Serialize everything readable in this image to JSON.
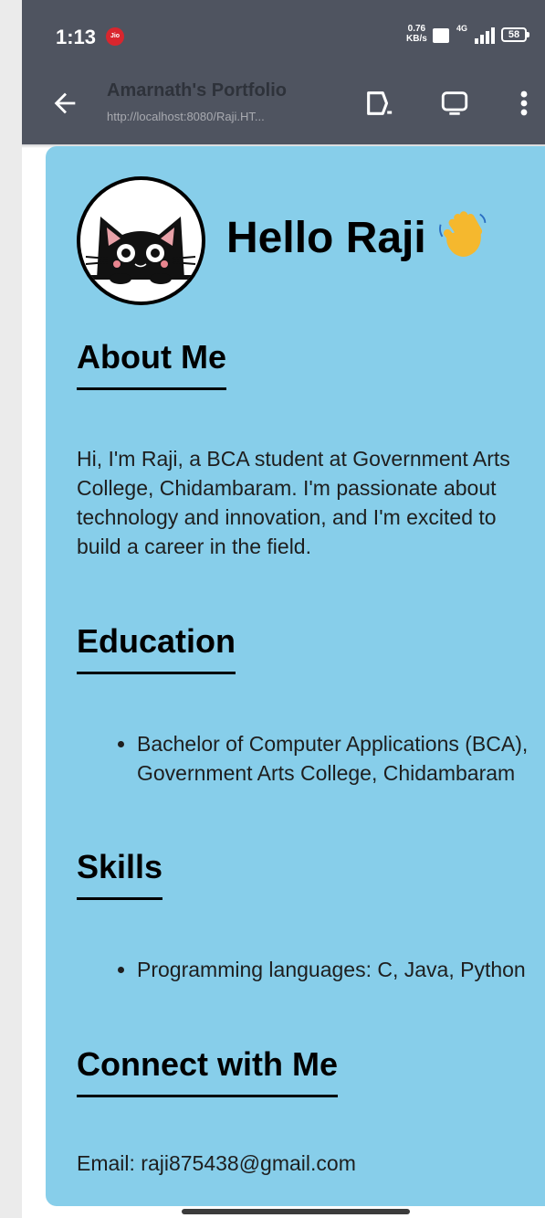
{
  "status_bar": {
    "time": "1:13",
    "carrier_badge": "Jio",
    "net_speed_value": "0.76",
    "net_speed_unit": "KB/s",
    "network_type": "4G",
    "battery": "58"
  },
  "toolbar": {
    "title": "Amarnath's Portfolio",
    "url": "http://localhost:8080/Raji.HT..."
  },
  "header": {
    "greeting": "Hello Raji"
  },
  "about": {
    "heading": "About Me",
    "text": "Hi, I'm Raji, a BCA student at Government Arts College, Chidambaram. I'm passionate about technology and innovation, and I'm excited to build a career in the field."
  },
  "education": {
    "heading": "Education",
    "items": [
      "Bachelor of Computer Applications (BCA), Government Arts College, Chidambaram"
    ]
  },
  "skills": {
    "heading": "Skills",
    "items": [
      "Programming languages: C, Java, Python"
    ]
  },
  "connect": {
    "heading": "Connect with Me",
    "email": "Email: raji875438@gmail.com"
  },
  "colors": {
    "chrome": "#4f5460",
    "card_background": "#87ceea"
  }
}
